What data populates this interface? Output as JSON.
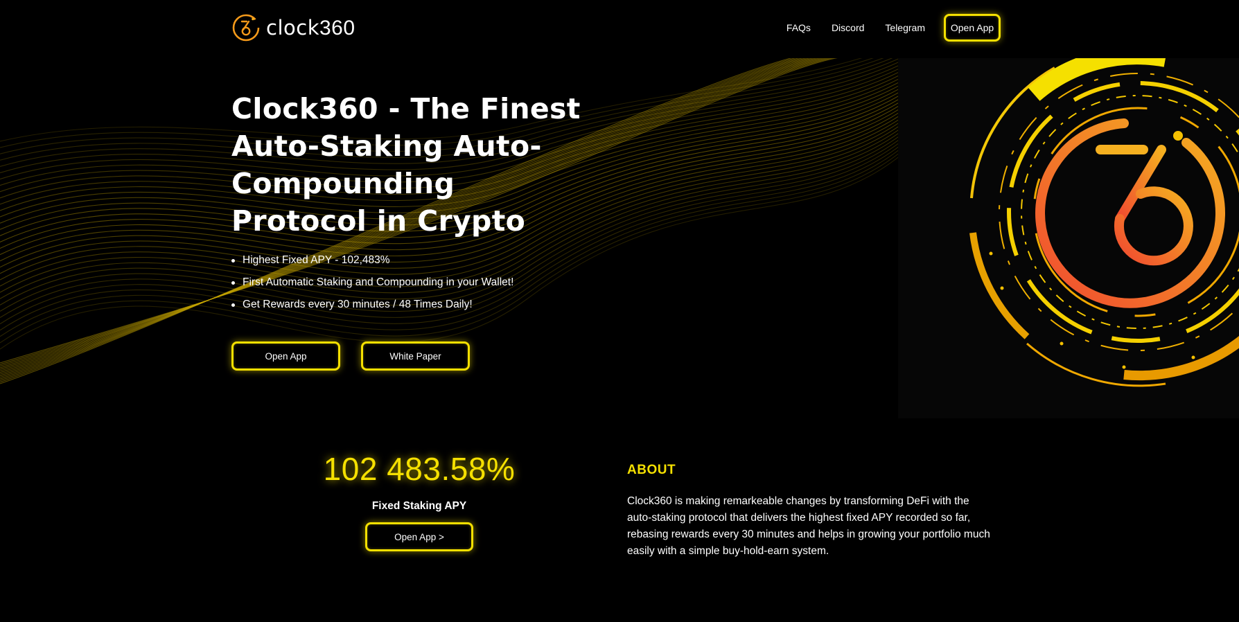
{
  "brand": {
    "name": "clock",
    "number": "360",
    "accent_color": "#f5e000",
    "logo_color": "#f59a1a"
  },
  "nav": {
    "links": [
      "FAQs",
      "Discord",
      "Telegram"
    ],
    "cta_label": "Open App"
  },
  "hero": {
    "title": "Clock360 - The Finest Auto-Staking Auto-Compounding Protocol in Crypto",
    "title_lines": [
      "Clock360 - The Finest",
      "Auto-Staking Auto-",
      "Compounding",
      "Protocol in Crypto"
    ],
    "bullets": [
      "Highest Fixed APY - 102,483%",
      "First Automatic Staking and Compounding in your Wallet!",
      "Get Rewards every 30 minutes / 48 Times Daily!"
    ],
    "primary_button": "Open App",
    "secondary_button": "White Paper"
  },
  "stat": {
    "value": "102 483.58%",
    "label": "Fixed Staking APY",
    "button": "Open App >"
  },
  "about": {
    "title": "ABOUT",
    "text": "Clock360 is making remarkeable changes by transforming DeFi with the auto-staking protocol that delivers the highest fixed APY recorded so far, rebasing rewards every 30 minutes and helps in growing your portfolio much easily with a simple buy-hold-earn system."
  }
}
